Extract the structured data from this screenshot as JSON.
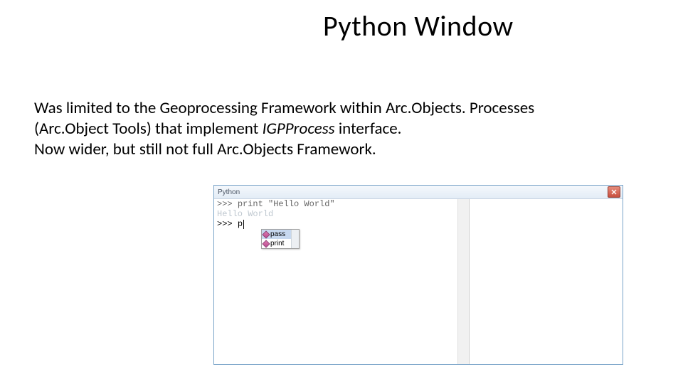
{
  "slide": {
    "title": "Python Window",
    "body_line1a": "Was limited to the Geoprocessing Framework within Arc.Objects. Processes",
    "body_line1b": "(Arc.Object Tools) that implement ",
    "body_italic": "IGPProcess",
    "body_line1c": " interface.",
    "body_line2": "Now wider, but still not full Arc.Objects Framework."
  },
  "python_window": {
    "title": "Python",
    "line1_prompt": ">>> ",
    "line1_code": "print \"Hello World\"",
    "output": "Hello World",
    "active_prompt": ">>> ",
    "typed": "p",
    "autocomplete": {
      "items": [
        "pass",
        "print"
      ],
      "selected_index": 0
    }
  }
}
